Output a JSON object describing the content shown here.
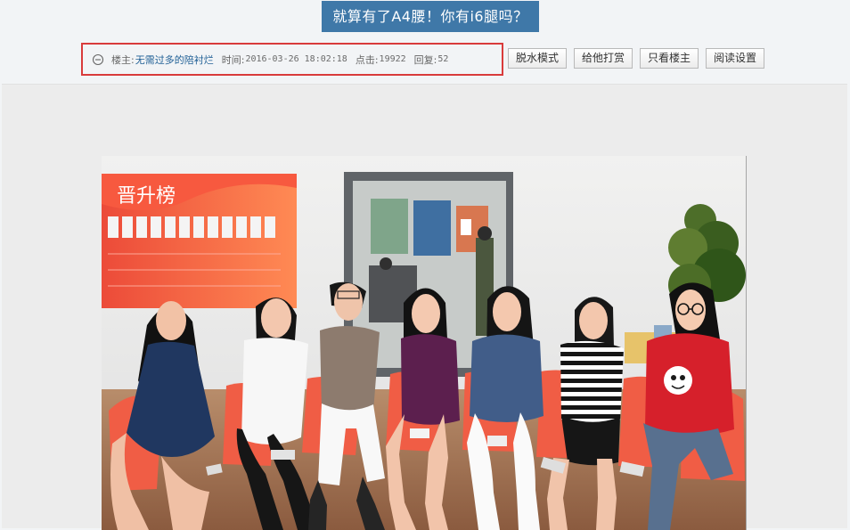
{
  "header": {
    "title": "就算有了A4腰！你有i6腿吗？"
  },
  "meta": {
    "author_label": "楼主:",
    "author_name": "无需过多的陪衬烂",
    "time_label": "时间:",
    "time_value": "2016-03-26 18:02:18",
    "clicks_label": "点击:",
    "clicks_value": "19922",
    "replies_label": "回复:",
    "replies_value": "52"
  },
  "actions": {
    "dehydrate_label": "脱水模式",
    "tip_label": "给他打赏",
    "author_only_label": "只看楼主",
    "reading_settings_label": "阅读设置"
  },
  "photo": {
    "banner_text": "晋升榜"
  },
  "colors": {
    "title_bg": "#3f78a8",
    "meta_border": "#d93b3b",
    "author_name": "#1f5f95",
    "panel_bg": "#ececec"
  },
  "icons": {
    "author": "author-icon"
  }
}
